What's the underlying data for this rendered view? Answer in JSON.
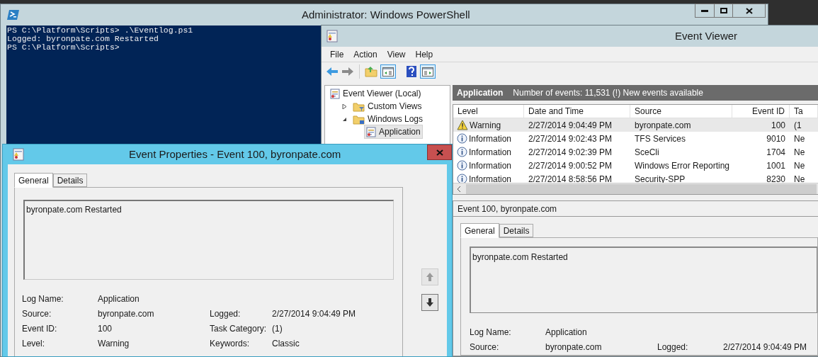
{
  "powershell": {
    "title": "Administrator: Windows PowerShell",
    "lines": [
      "PS C:\\Platform\\Scripts> .\\Eventlog.ps1",
      "Logged: byronpate.com Restarted",
      "PS C:\\Platform\\Scripts>"
    ]
  },
  "event_viewer": {
    "title": "Event Viewer",
    "menu": [
      "File",
      "Action",
      "View",
      "Help"
    ],
    "tree": [
      {
        "label": "Event Viewer (Local)",
        "kind": "root",
        "selected": false,
        "children": [
          {
            "label": "Custom Views",
            "kind": "filter",
            "expanded": false,
            "selected": false
          },
          {
            "label": "Windows Logs",
            "kind": "logs",
            "expanded": true,
            "selected": false,
            "children": [
              {
                "label": "Application",
                "kind": "log",
                "selected": true
              }
            ]
          }
        ]
      }
    ],
    "log_header": {
      "name": "Application",
      "summary": "Number of events: 11,531 (!) New events available"
    },
    "table": {
      "columns": [
        "Level",
        "Date and Time",
        "Source",
        "Event ID",
        "Ta"
      ],
      "rows": [
        {
          "kind": "warning",
          "level": "Warning",
          "date": "2/27/2014 9:04:49 PM",
          "source": "byronpate.com",
          "event_id": "100",
          "task": "(1",
          "selected": true
        },
        {
          "kind": "information",
          "level": "Information",
          "date": "2/27/2014 9:02:43 PM",
          "source": "TFS Services",
          "event_id": "9010",
          "task": "Ne",
          "selected": false
        },
        {
          "kind": "information",
          "level": "Information",
          "date": "2/27/2014 9:02:39 PM",
          "source": "SceCli",
          "event_id": "1704",
          "task": "Ne",
          "selected": false
        },
        {
          "kind": "information",
          "level": "Information",
          "date": "2/27/2014 9:00:52 PM",
          "source": "Windows Error Reporting",
          "event_id": "1001",
          "task": "Ne",
          "selected": false
        },
        {
          "kind": "information",
          "level": "Information",
          "date": "2/27/2014 8:58:56 PM",
          "source": "Security-SPP",
          "event_id": "8230",
          "task": "Ne",
          "selected": false
        }
      ]
    },
    "preview": {
      "title": "Event 100, byronpate.com",
      "tabs": [
        {
          "label": "General",
          "selected": true
        },
        {
          "label": "Details",
          "selected": false
        }
      ],
      "message": "byronpate.com Restarted",
      "fields": [
        [
          {
            "label": "Log Name:",
            "value": "Application"
          }
        ],
        [
          {
            "label": "Source:",
            "value": "byronpate.com"
          },
          {
            "label": "Logged:",
            "value": "2/27/2014 9:04:49 PM"
          }
        ]
      ]
    }
  },
  "event_properties": {
    "title": "Event Properties - Event 100, byronpate.com",
    "tabs": [
      {
        "label": "General",
        "selected": true
      },
      {
        "label": "Details",
        "selected": false
      }
    ],
    "message": "byronpate.com Restarted",
    "fields": [
      [
        {
          "label": "Log Name:",
          "value": "Application"
        }
      ],
      [
        {
          "label": "Source:",
          "value": "byronpate.com"
        },
        {
          "label": "Logged:",
          "value": "2/27/2014 9:04:49 PM"
        }
      ],
      [
        {
          "label": "Event ID:",
          "value": "100"
        },
        {
          "label": "Task Category:",
          "value": "(1)"
        }
      ],
      [
        {
          "label": "Level:",
          "value": "Warning"
        },
        {
          "label": "Keywords:",
          "value": "Classic"
        }
      ]
    ]
  }
}
